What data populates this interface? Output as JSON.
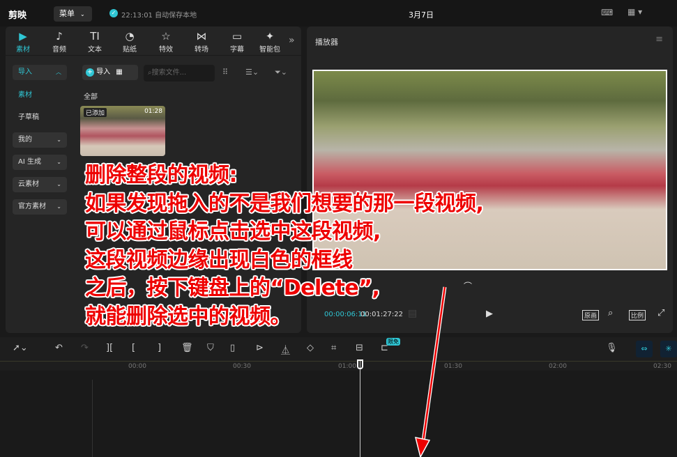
{
  "app": {
    "logo": "剪映",
    "menu": "菜单",
    "save_status": "22:13:01 自动保存本地",
    "title": "3月7日"
  },
  "tabs": [
    {
      "label": "素材",
      "icon": "▶"
    },
    {
      "label": "音频",
      "icon": "♪"
    },
    {
      "label": "文本",
      "icon": "TI"
    },
    {
      "label": "贴纸",
      "icon": "◔"
    },
    {
      "label": "特效",
      "icon": "☆"
    },
    {
      "label": "转场",
      "icon": "⋈"
    },
    {
      "label": "字幕",
      "icon": "▭"
    },
    {
      "label": "智能包",
      "icon": "✦"
    }
  ],
  "sidebar": [
    {
      "label": "导入"
    },
    {
      "label": "素材"
    },
    {
      "label": "子草稿"
    },
    {
      "label": "我的"
    },
    {
      "label": "AI 生成"
    },
    {
      "label": "云素材"
    },
    {
      "label": "官方素材"
    }
  ],
  "media": {
    "import_label": "导入",
    "search_placeholder": "搜索文件...",
    "section": "全部",
    "clip_badge": "已添加",
    "clip_duration": "01:28"
  },
  "player": {
    "title": "播放器",
    "current_time": "00:00:06:11",
    "total_time": "00:01:27:22",
    "btn_original": "原画",
    "btn_ratio": "比例"
  },
  "timeline": {
    "badge": "限免",
    "ticks": [
      "00:00",
      "00:30",
      "01:00",
      "01:30",
      "02:00",
      "02:30"
    ]
  },
  "annotation": {
    "lines": [
      "删除整段的视频:",
      "如果发现拖入的不是我们想要的那一段视频,",
      "可以通过鼠标点击选中这段视频,",
      "这段视频边缘出现白色的框线",
      "之后，按下键盘上的“Delete”,",
      "就能删除选中的视频。"
    ]
  },
  "colors": {
    "accent": "#2fc6d4",
    "annotation": "#e00000"
  }
}
